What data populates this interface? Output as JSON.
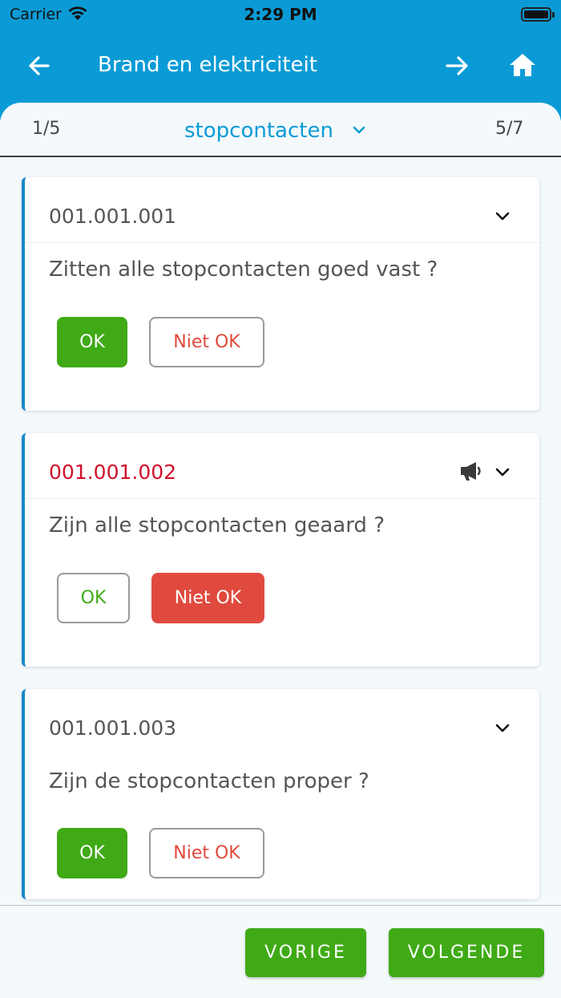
{
  "status_bar": {
    "carrier": "Carrier",
    "time": "2:29 PM"
  },
  "header": {
    "title": "Brand en elektriciteit"
  },
  "subbar": {
    "left": "1/5",
    "section": "stopcontacten",
    "right": "5/7"
  },
  "cards": [
    {
      "code": "001.001.001",
      "question": "Zitten alle stopcontacten goed vast ?",
      "ok_label": "OK",
      "notok_label": "Niet OK",
      "status": "ok"
    },
    {
      "code": "001.001.002",
      "question": "Zijn alle stopcontacten geaard ?",
      "ok_label": "OK",
      "notok_label": "Niet OK",
      "status": "not_ok",
      "icons": [
        "megaphone-icon"
      ]
    },
    {
      "code": "001.001.003",
      "question": "Zijn de stopcontacten proper ?",
      "ok_label": "OK",
      "notok_label": "Niet OK",
      "status": "ok"
    }
  ],
  "footer": {
    "prev_label": "VORIGE",
    "next_label": "VOLGENDE"
  },
  "colors": {
    "header": "#0a9bd6",
    "accent_green": "#3faa16",
    "accent_red": "#e04a3e",
    "code_red": "#d0112b",
    "card_border": "#1689c8"
  }
}
